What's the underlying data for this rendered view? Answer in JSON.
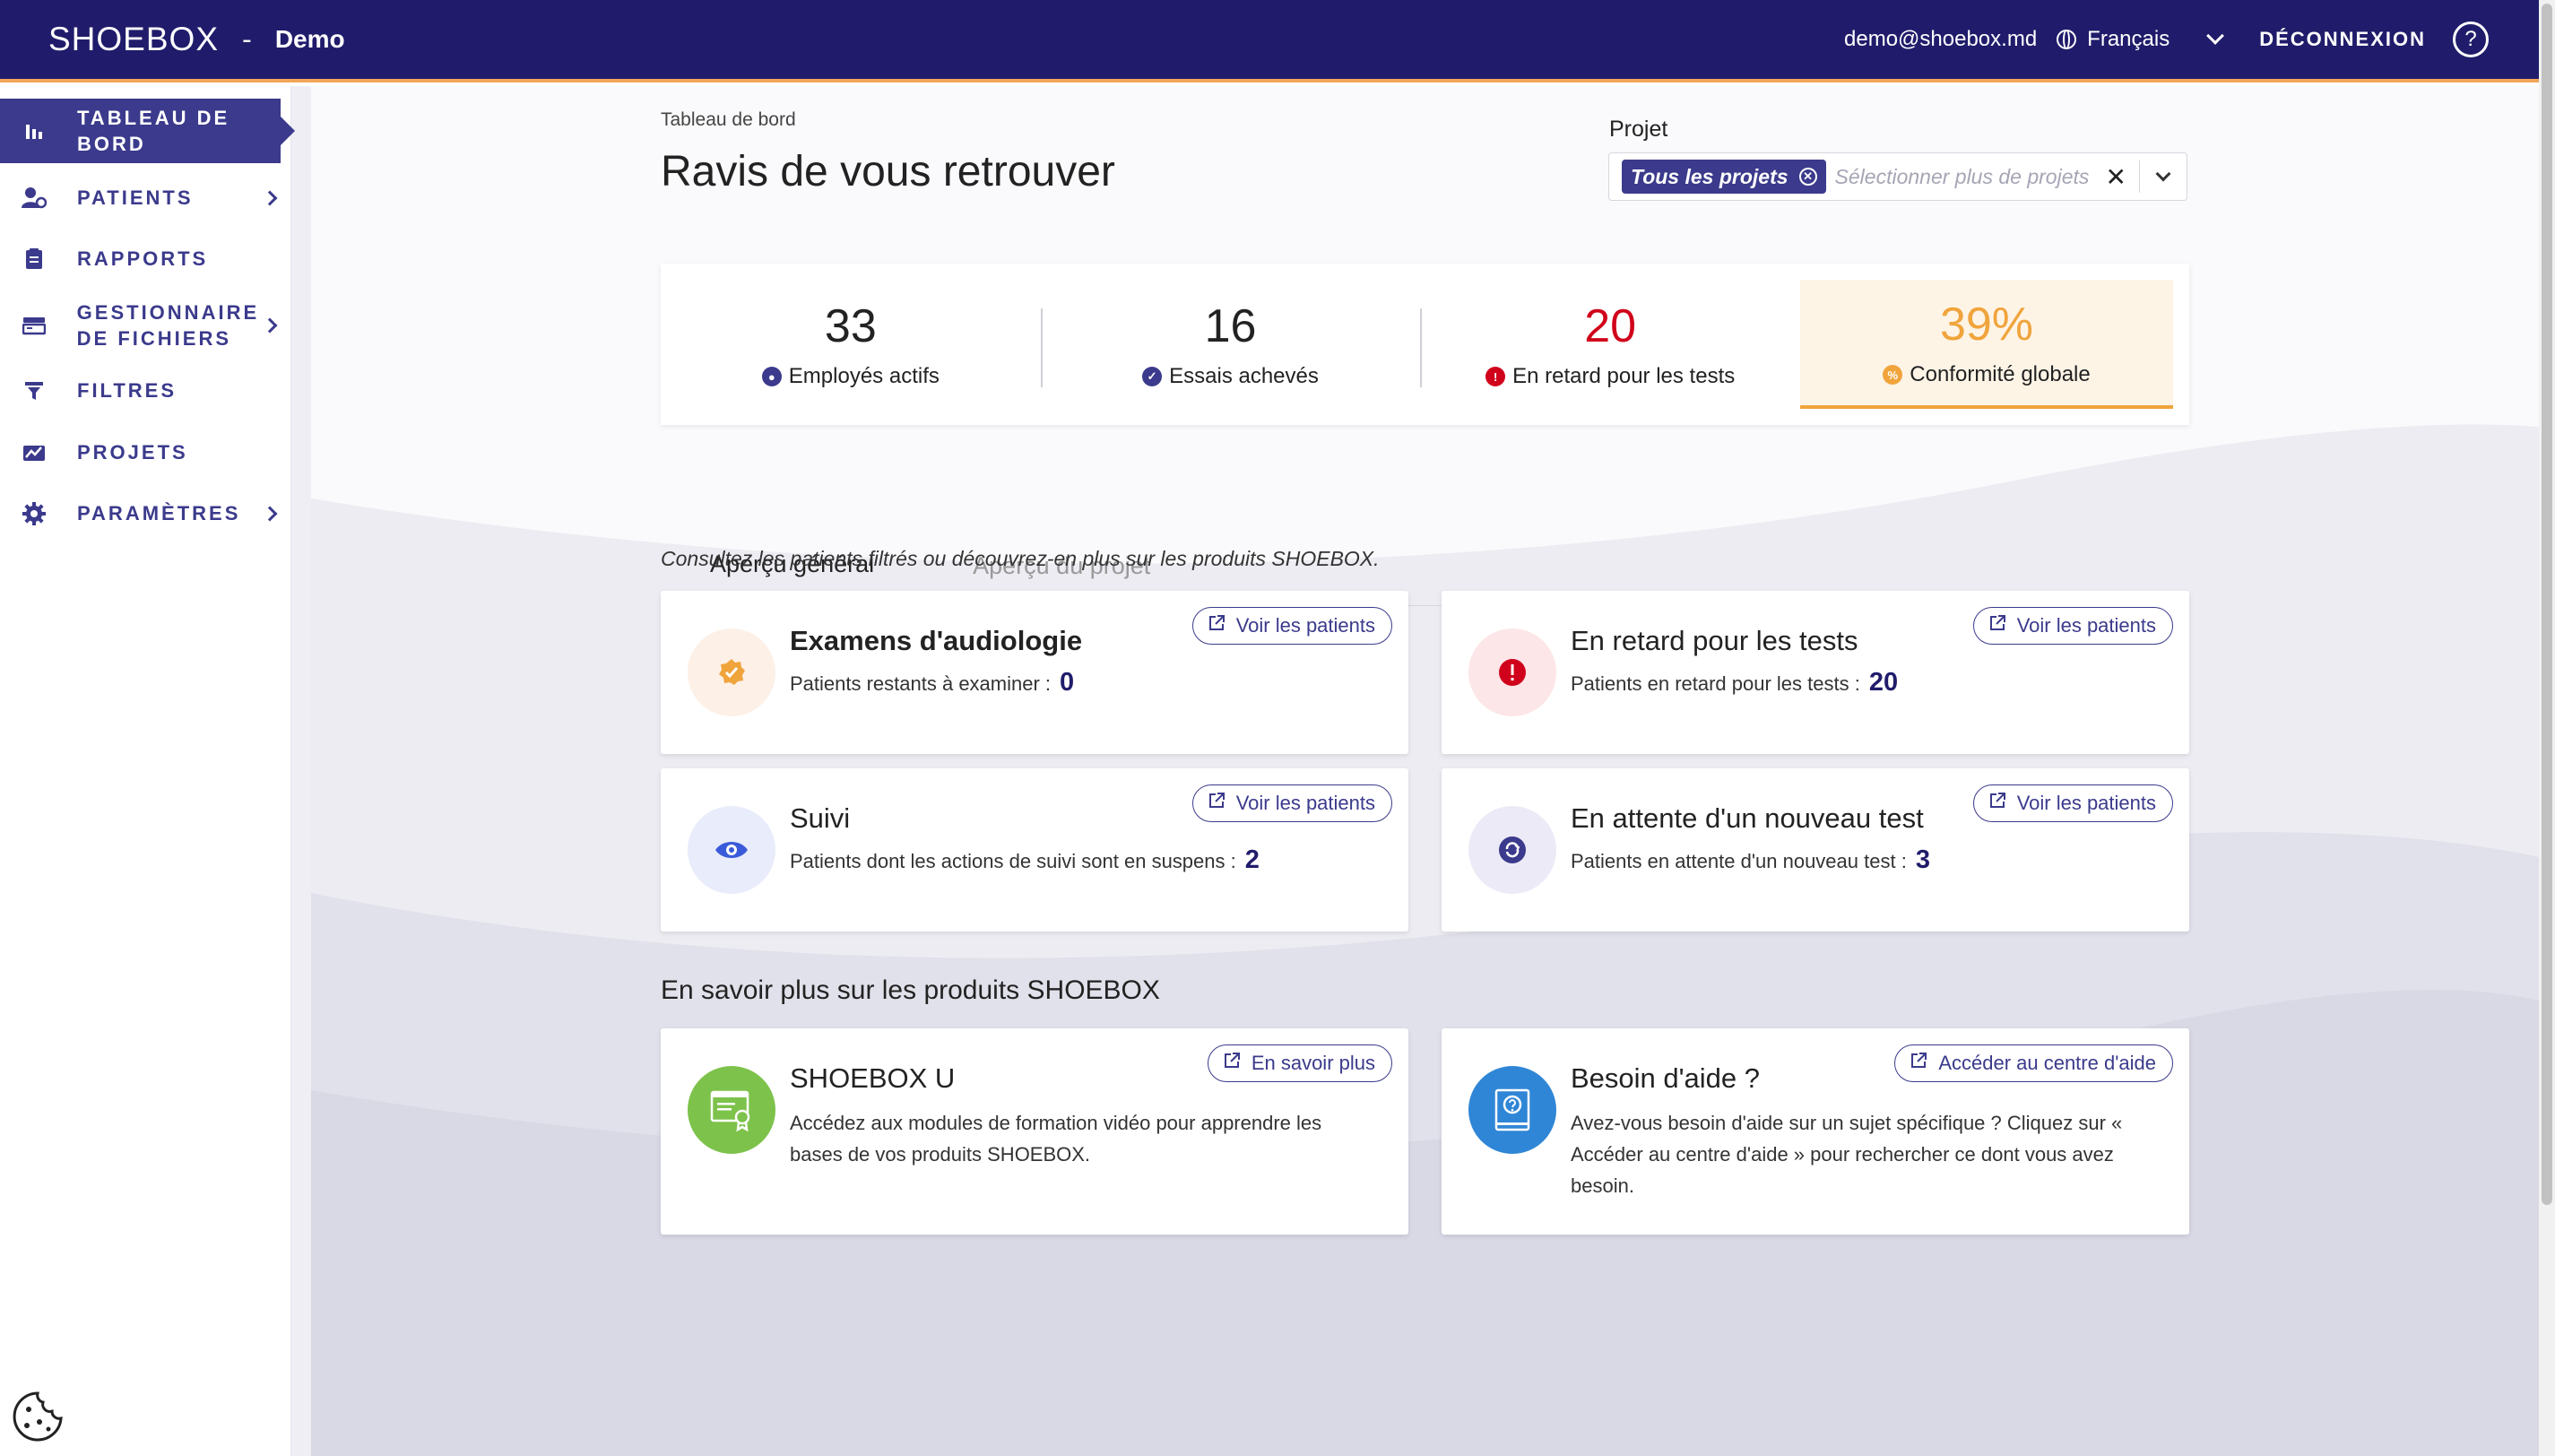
{
  "header": {
    "logo": "SHOEBOX",
    "separator": "-",
    "organization": "Demo",
    "email": "demo@shoebox.md",
    "language": "Français",
    "logout": "DÉCONNEXION",
    "help_glyph": "?"
  },
  "sidebar": {
    "items": [
      {
        "label": "TABLEAU DE BORD",
        "icon": "bar-chart-icon",
        "active": true
      },
      {
        "label": "PATIENTS",
        "icon": "patients-icon",
        "has_children": true
      },
      {
        "label": "RAPPORTS",
        "icon": "report-icon"
      },
      {
        "label": "GESTIONNAIRE DE FICHIERS",
        "icon": "file-manager-icon",
        "has_children": true
      },
      {
        "label": "FILTRES",
        "icon": "filter-icon"
      },
      {
        "label": "PROJETS",
        "icon": "projects-icon"
      },
      {
        "label": "PARAMÈTRES",
        "icon": "gear-icon",
        "has_children": true
      }
    ]
  },
  "main": {
    "breadcrumb": "Tableau de bord",
    "title": "Ravis de vous retrouver",
    "project_filter": {
      "label": "Projet",
      "chip": "Tous les projets",
      "placeholder": "Sélectionner plus de projets"
    },
    "stats": [
      {
        "value": "33",
        "label": "Employés actifs",
        "color": "#222222",
        "icon_color": "#3b3a8c"
      },
      {
        "value": "16",
        "label": "Essais achevés",
        "color": "#222222",
        "icon_color": "#3b3a8c"
      },
      {
        "value": "20",
        "label": "En retard pour les tests",
        "color": "#d0021b",
        "icon_color": "#d0021b"
      },
      {
        "value": "39%",
        "label": "Conformité globale",
        "color": "#f0a43c",
        "icon_color": "#f0a43c"
      }
    ],
    "tabs": [
      "Aperçu général",
      "Aperçu du projet"
    ],
    "subtitle": "Consultez les patients filtrés ou découvrez-en plus sur les produits SHOEBOX.",
    "patient_cards": [
      {
        "title": "Examens d'audiologie",
        "text": "Patients restants à examiner :",
        "count": "0",
        "button": "Voir les patients"
      },
      {
        "title": "En retard pour les tests",
        "text": "Patients en retard pour les tests :",
        "count": "20",
        "button": "Voir les patients"
      },
      {
        "title": "Suivi",
        "text": "Patients dont les actions de suivi sont en suspens :",
        "count": "2",
        "button": "Voir les patients"
      },
      {
        "title": "En attente d'un nouveau test",
        "text": "Patients en attente d'un nouveau test :",
        "count": "3",
        "button": "Voir les patients"
      }
    ],
    "learn_section": "En savoir plus sur les produits SHOEBOX",
    "info_cards": [
      {
        "title": "SHOEBOX U",
        "desc": "Accédez aux modules de formation vidéo pour apprendre les bases de vos produits SHOEBOX.",
        "button": "En savoir plus"
      },
      {
        "title": "Besoin d'aide ?",
        "desc": "Avez-vous besoin d'aide sur un sujet spécifique ? Cliquez sur « Accéder au centre d'aide » pour rechercher ce dont vous avez besoin.",
        "button": "Accéder au centre d'aide"
      }
    ]
  },
  "colors": {
    "brand": "#201c6b",
    "accent": "#3b3a8c",
    "warning": "#f0a43c",
    "danger": "#d0021b"
  }
}
